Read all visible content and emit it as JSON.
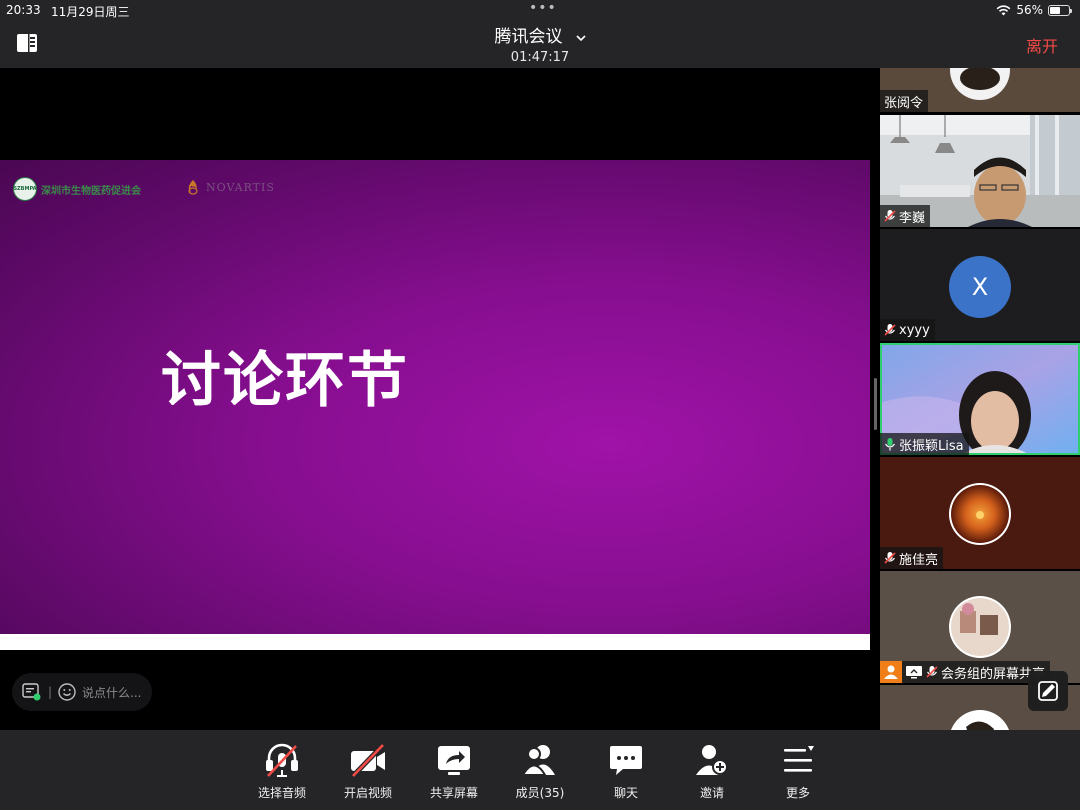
{
  "status_bar": {
    "time": "20:33",
    "date": "11月29日周三",
    "battery_percent": "56%",
    "battery_level": 0.56
  },
  "header": {
    "meeting_title": "腾讯会议",
    "timer": "01:47:17",
    "leave_label": "离开"
  },
  "slide": {
    "org_logo_text": "深圳市生物医药促进会",
    "org_logo_abbr": "SZBMPA",
    "sponsor_logo_text": "NOVARTIS",
    "title": "讨论环节"
  },
  "chat": {
    "placeholder": "说点什么..."
  },
  "participants": [
    {
      "name": "张阅令",
      "mic": "none"
    },
    {
      "name": "李巍",
      "mic": "muted"
    },
    {
      "name": "xyyy",
      "mic": "muted",
      "avatar_letter": "X"
    },
    {
      "name": "张振颖Lisa",
      "mic": "active"
    },
    {
      "name": "施佳亮",
      "mic": "muted"
    },
    {
      "name": "会务组的屏幕共享",
      "mic": "muted"
    }
  ],
  "toolbar": {
    "audio": "选择音频",
    "video": "开启视频",
    "share": "共享屏幕",
    "members": "成员(35)",
    "chat": "聊天",
    "invite": "邀请",
    "more": "更多"
  },
  "colors": {
    "leave": "#f24a45",
    "active_speaker": "#2fcf6f",
    "avatar_blue": "#3b73c9",
    "slide_purple": "#860e8f"
  }
}
